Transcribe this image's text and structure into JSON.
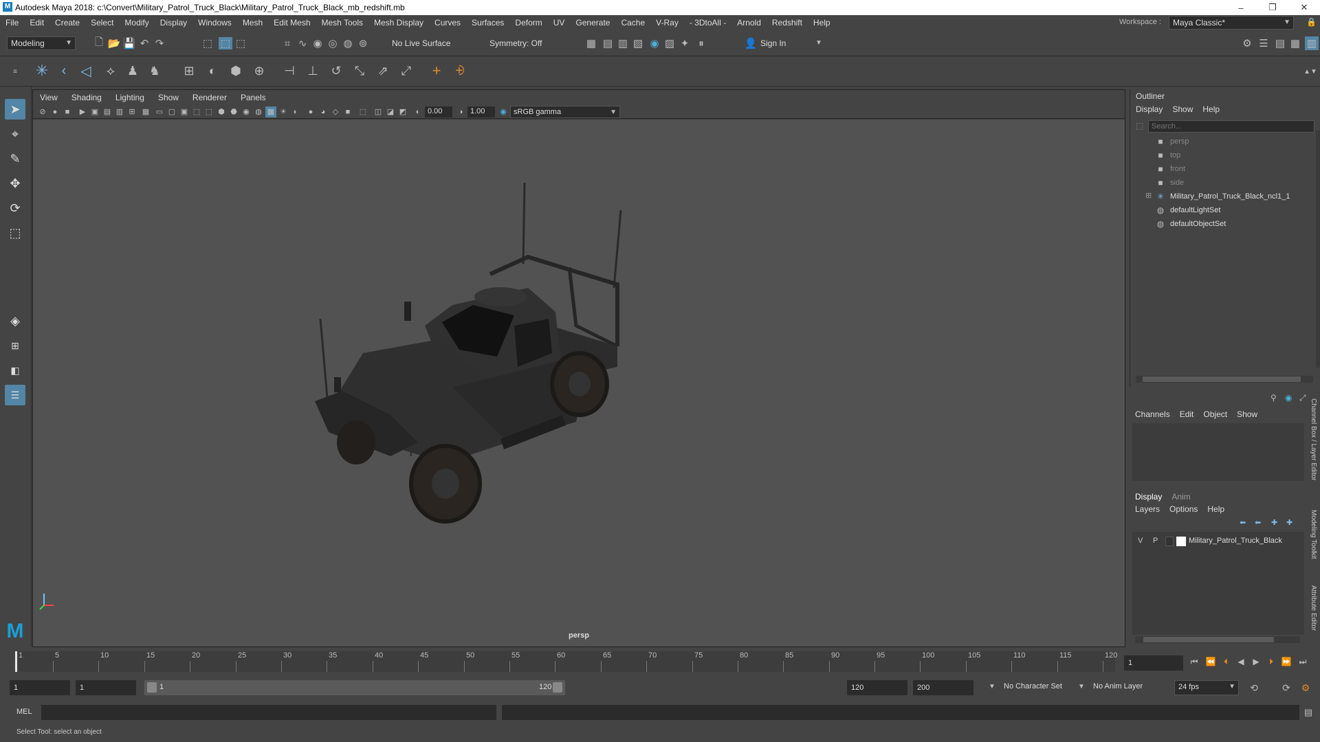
{
  "window": {
    "title": "Autodesk Maya 2018: c:\\Convert\\Military_Patrol_Truck_Black\\Military_Patrol_Truck_Black_mb_redshift.mb",
    "minimize": "–",
    "maximize": "❐",
    "close": "✕"
  },
  "menubar": {
    "items": [
      "File",
      "Edit",
      "Create",
      "Select",
      "Modify",
      "Display",
      "Windows",
      "Mesh",
      "Edit Mesh",
      "Mesh Tools",
      "Mesh Display",
      "Curves",
      "Surfaces",
      "Deform",
      "UV",
      "Generate",
      "Cache",
      "V-Ray",
      "- 3DtoAll -",
      "Arnold",
      "Redshift",
      "Help"
    ],
    "workspace_label": "Workspace :",
    "workspace_value": "Maya Classic*"
  },
  "statusline": {
    "mode": "Modeling",
    "live_surface": "No Live Surface",
    "symmetry": "Symmetry: Off",
    "sign_in": "Sign In"
  },
  "viewport": {
    "menu": [
      "View",
      "Shading",
      "Lighting",
      "Show",
      "Renderer",
      "Panels"
    ],
    "exposure": "0.00",
    "gamma": "1.00",
    "color_space": "sRGB gamma",
    "camera": "persp"
  },
  "outliner": {
    "title": "Outliner",
    "menu": [
      "Display",
      "Show",
      "Help"
    ],
    "search_placeholder": "Search...",
    "items": [
      {
        "label": "persp",
        "dim": true,
        "icon": "camera-icon"
      },
      {
        "label": "top",
        "dim": true,
        "icon": "camera-icon"
      },
      {
        "label": "front",
        "dim": true,
        "icon": "camera-icon"
      },
      {
        "label": "side",
        "dim": true,
        "icon": "camera-icon"
      },
      {
        "label": "Military_Patrol_Truck_Black_ncl1_1",
        "dim": false,
        "icon": "group-icon",
        "expandable": true
      },
      {
        "label": "defaultLightSet",
        "dim": false,
        "icon": "set-icon"
      },
      {
        "label": "defaultObjectSet",
        "dim": false,
        "icon": "set-icon"
      }
    ]
  },
  "channelbox": {
    "menu": [
      "Channels",
      "Edit",
      "Object",
      "Show"
    ]
  },
  "layereditor": {
    "tabs": [
      "Display",
      "Anim"
    ],
    "menu": [
      "Layers",
      "Options",
      "Help"
    ],
    "layer": {
      "v": "V",
      "p": "P",
      "name": "Military_Patrol_Truck_Black"
    }
  },
  "side_tabs": [
    "Channel Box / Layer Editor",
    "Modeling Toolkit",
    "Attribute Editor"
  ],
  "timeline": {
    "ticks": [
      "1",
      "5",
      "10",
      "15",
      "20",
      "25",
      "30",
      "35",
      "40",
      "45",
      "50",
      "55",
      "60",
      "65",
      "70",
      "75",
      "80",
      "85",
      "90",
      "95",
      "100",
      "105",
      "110",
      "115",
      "120"
    ],
    "current_frame": "1"
  },
  "range": {
    "start": "1",
    "playback_start": "1",
    "slider_start": "1",
    "slider_end": "120",
    "playback_end": "120",
    "end": "200",
    "character_set": "No Character Set",
    "anim_layer": "No Anim Layer",
    "fps": "24 fps"
  },
  "cmdline": {
    "label": "MEL"
  },
  "helpline": {
    "text": "Select Tool: select an object"
  }
}
